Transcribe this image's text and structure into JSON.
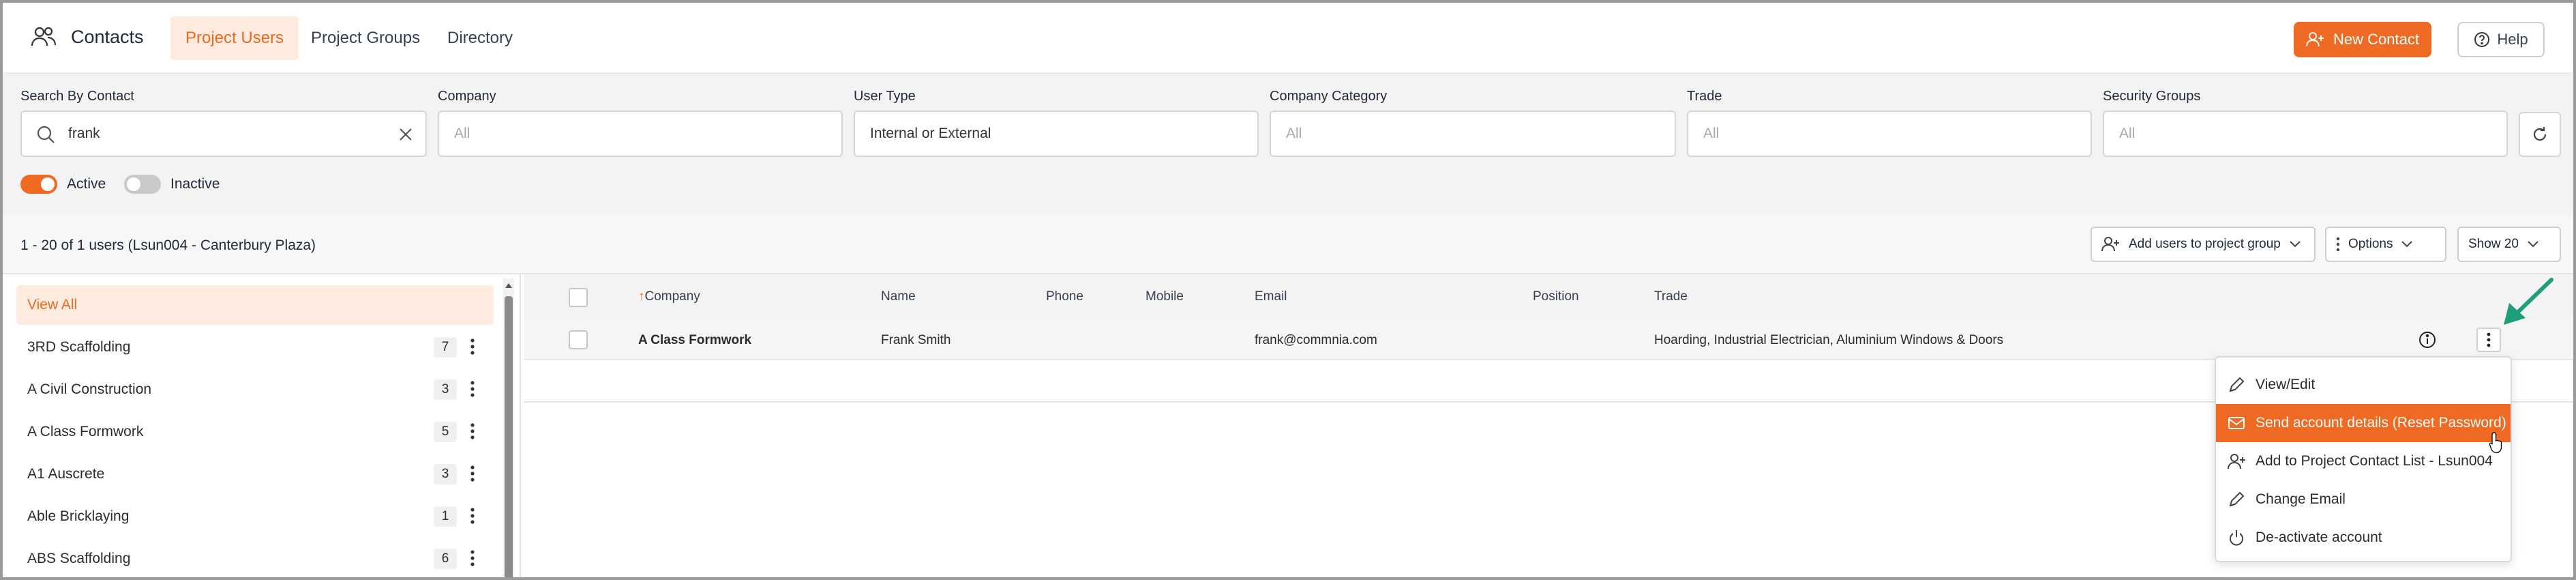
{
  "app": {
    "title": "Contacts",
    "tabs": [
      {
        "label": "Project Users",
        "active": true
      },
      {
        "label": "Project Groups",
        "active": false
      },
      {
        "label": "Directory",
        "active": false
      }
    ],
    "new_contact_label": "New Contact",
    "help_label": "Help",
    "accent_color": "#ef6a22"
  },
  "filters": {
    "search": {
      "label": "Search By Contact",
      "value": "frank"
    },
    "company": {
      "label": "Company",
      "placeholder": "All"
    },
    "user_type": {
      "label": "User Type",
      "value": "Internal or External"
    },
    "company_category": {
      "label": "Company Category",
      "placeholder": "All"
    },
    "trade": {
      "label": "Trade",
      "placeholder": "All"
    },
    "security_groups": {
      "label": "Security Groups",
      "placeholder": "All"
    },
    "active_label": "Active",
    "inactive_label": "Inactive",
    "active_on": true,
    "inactive_on": false
  },
  "summary": {
    "text": "1 - 20 of 1 users (Lsun004 - Canterbury Plaza)",
    "add_to_group_label": "Add users to project group",
    "options_label": "Options",
    "show_label": "Show 20"
  },
  "sidebar": {
    "items": [
      {
        "label": "View All",
        "count": "",
        "active": true
      },
      {
        "label": "3RD Scaffolding",
        "count": "7"
      },
      {
        "label": "A Civil Construction",
        "count": "3"
      },
      {
        "label": "A Class Formwork",
        "count": "5"
      },
      {
        "label": "A1 Auscrete",
        "count": "3"
      },
      {
        "label": "Able Bricklaying",
        "count": "1"
      },
      {
        "label": "ABS Scaffolding",
        "count": "6"
      }
    ]
  },
  "table": {
    "columns": {
      "company": "Company",
      "company_sort_marker": "↑",
      "name": "Name",
      "phone": "Phone",
      "mobile": "Mobile",
      "email": "Email",
      "position": "Position",
      "trade": "Trade"
    },
    "rows": [
      {
        "company": "A Class Formwork",
        "name": "Frank Smith",
        "phone": "",
        "mobile": "",
        "email": "frank@commnia.com",
        "position": "",
        "trade": "Hoarding, Industrial Electrician, Aluminium Windows & Doors"
      }
    ]
  },
  "row_menu": {
    "items": [
      {
        "label": "View/Edit",
        "icon": "pencil-icon"
      },
      {
        "label": "Send account details (Reset Password)",
        "icon": "envelope-icon",
        "active": true
      },
      {
        "label": "Add to Project Contact List - Lsun004",
        "icon": "add-user-icon"
      },
      {
        "label": "Change Email",
        "icon": "pencil-icon"
      },
      {
        "label": "De-activate account",
        "icon": "power-icon"
      }
    ]
  }
}
